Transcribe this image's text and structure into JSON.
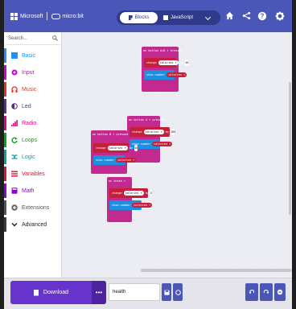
{
  "header": {
    "brand_ms": "Microsoft",
    "brand_mb": "micro:bit",
    "tab_blocks": "Blocks",
    "tab_js": "JavaScript",
    "icons": [
      "home-icon",
      "share-icon",
      "help-icon",
      "settings-icon"
    ]
  },
  "toolbox": {
    "search_placeholder": "Search...",
    "categories": [
      {
        "label": "Basic",
        "color": "#1e90ff"
      },
      {
        "label": "Input",
        "color": "#d400d4"
      },
      {
        "label": "Music",
        "color": "#e63022"
      },
      {
        "label": "Led",
        "color": "#5c2d91"
      },
      {
        "label": "Radio",
        "color": "#e3008c"
      },
      {
        "label": "Loops",
        "color": "#00aa00"
      },
      {
        "label": "Logic",
        "color": "#00a4a6"
      },
      {
        "label": "Variables",
        "color": "#dc143c"
      },
      {
        "label": "Math",
        "color": "#9400d3"
      },
      {
        "label": "Extensions",
        "color": "#555555"
      },
      {
        "label": "Advanced",
        "color": "#3c3c3c"
      }
    ]
  },
  "workspace": {
    "blocks": [
      {
        "event": "on button A+B ▾ pressed",
        "change": "change",
        "var": "calories ▾",
        "by": "by",
        "value": "10",
        "show": "show number",
        "show_var": "calories ▾"
      },
      {
        "event": "on button A ▾ pressed",
        "change": "change",
        "var": "calories ▾",
        "by": "by",
        "value": "100",
        "show": "show number",
        "show_var": "calories ▾"
      },
      {
        "event": "on button B ▾ pressed",
        "change": "change",
        "var": "calories ▾",
        "by": "by",
        "value": "50",
        "show": "show number",
        "show_var": "calories ▾"
      },
      {
        "event": "on shake ▾",
        "change": "change",
        "var": "calories ▾",
        "by": "by",
        "value": "5",
        "show": "show number",
        "show_var": "calories ▾"
      }
    ]
  },
  "footer": {
    "download_label": "Download",
    "more_label": "•••",
    "project_name": "health"
  },
  "colors": {
    "header": "#4a57b8",
    "download": "#6633cc",
    "event_block": "#c32a8f",
    "variable_block": "#c51f3a",
    "basic_block": "#1e8fe0"
  }
}
